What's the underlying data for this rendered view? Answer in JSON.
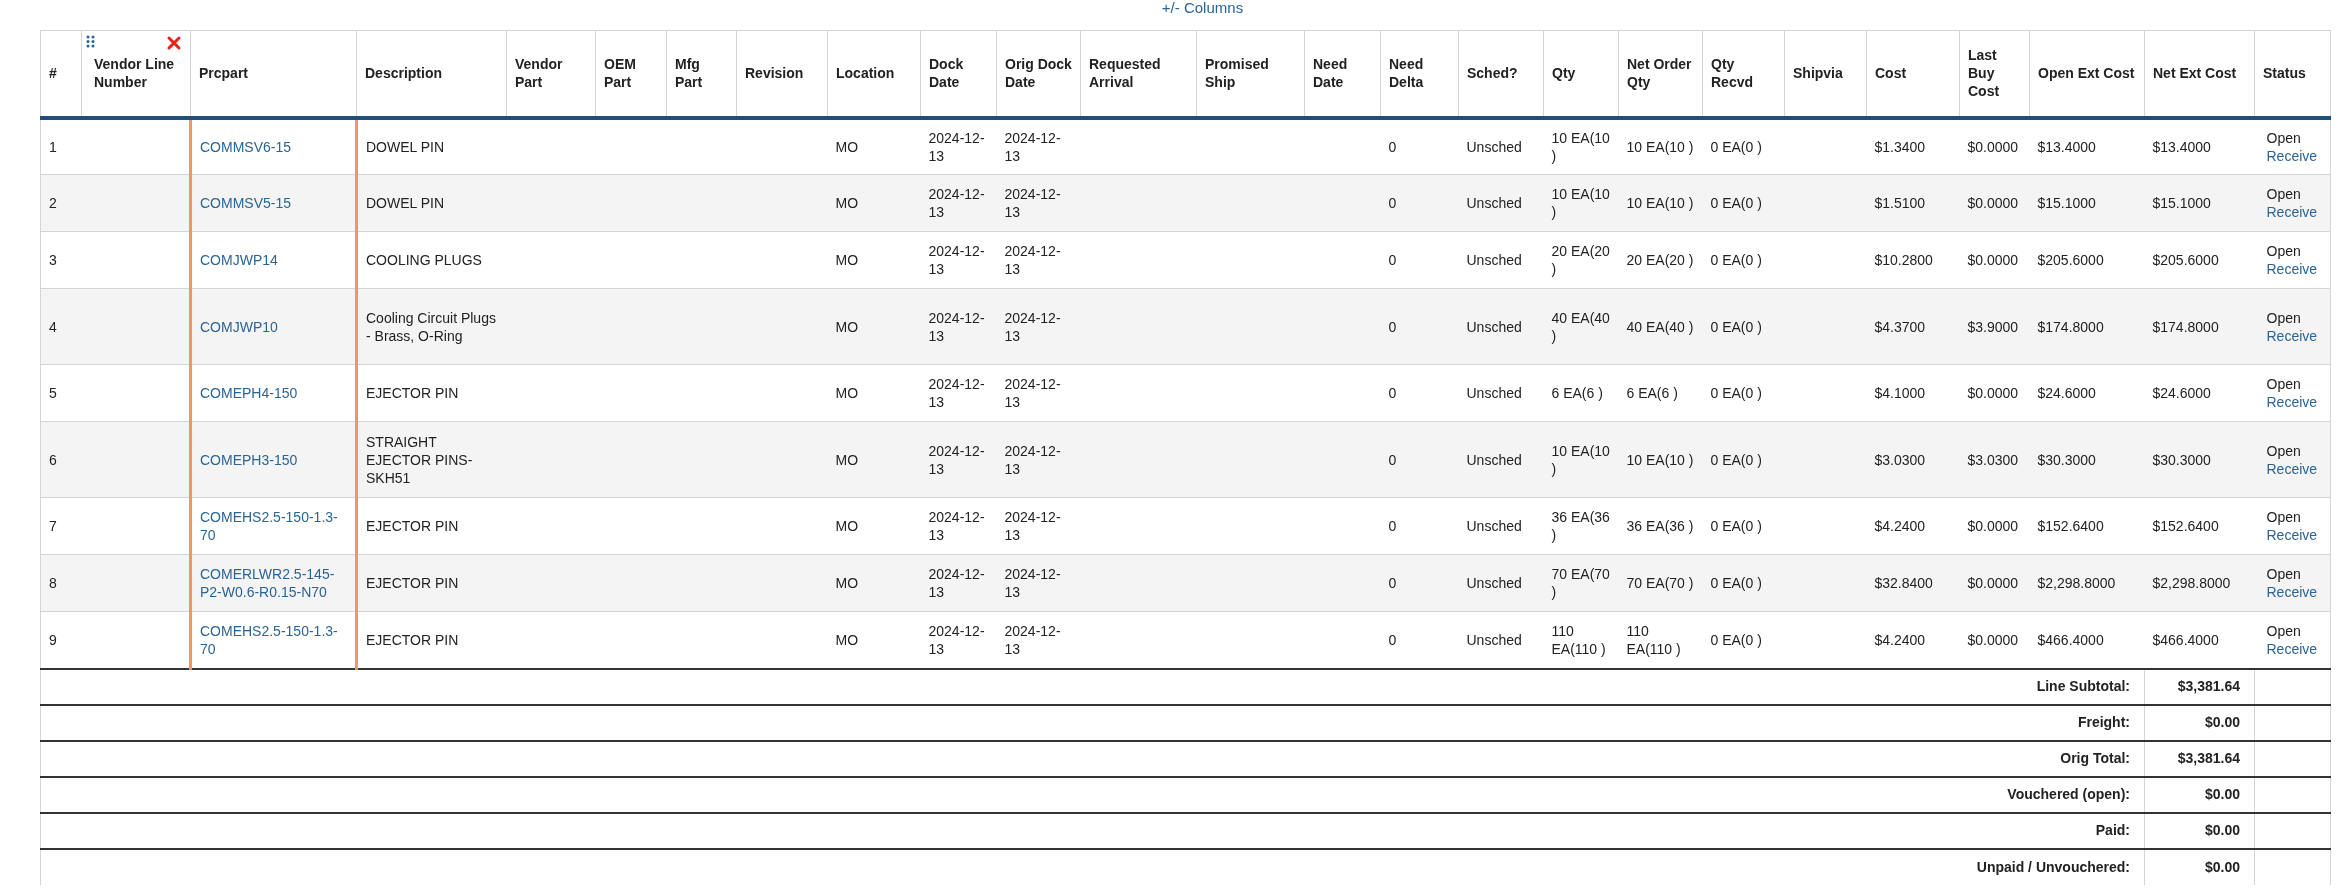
{
  "columns_toggle": "+/- Columns",
  "columns": [
    "#",
    "Vendor Line Number",
    "Prcpart",
    "Description",
    "Vendor Part",
    "OEM Part",
    "Mfg Part",
    "Revision",
    "Location",
    "Dock Date",
    "Orig Dock Date",
    "Requested Arrival",
    "Promised Ship",
    "Need Date",
    "Need Delta",
    "Sched?",
    "Qty",
    "Net Order Qty",
    "Qty Recvd",
    "Shipvia",
    "Cost",
    "Last Buy Cost",
    "Open Ext Cost",
    "Net Ext Cost",
    "Status"
  ],
  "rows": [
    {
      "number": "1",
      "prcpart": "COMMSV6-15",
      "description": "DOWEL PIN",
      "location": "MO",
      "dock_date": "2024-12-13",
      "orig_dock_date": "2024-12-13",
      "need_delta": "0",
      "sched": "Unsched",
      "qty": "10 EA(10 )",
      "net_order_qty": "10 EA(10 )",
      "qty_recvd": "0 EA(0 )",
      "cost": "$1.3400",
      "last_buy_cost": "$0.0000",
      "open_ext_cost": "$13.4000",
      "net_ext_cost": "$13.4000",
      "status": "Open",
      "action": "Receive"
    },
    {
      "number": "2",
      "prcpart": "COMMSV5-15",
      "description": "DOWEL PIN",
      "location": "MO",
      "dock_date": "2024-12-13",
      "orig_dock_date": "2024-12-13",
      "need_delta": "0",
      "sched": "Unsched",
      "qty": "10 EA(10 )",
      "net_order_qty": "10 EA(10 )",
      "qty_recvd": "0 EA(0 )",
      "cost": "$1.5100",
      "last_buy_cost": "$0.0000",
      "open_ext_cost": "$15.1000",
      "net_ext_cost": "$15.1000",
      "status": "Open",
      "action": "Receive"
    },
    {
      "number": "3",
      "prcpart": "COMJWP14",
      "description": "COOLING PLUGS",
      "location": "MO",
      "dock_date": "2024-12-13",
      "orig_dock_date": "2024-12-13",
      "need_delta": "0",
      "sched": "Unsched",
      "qty": "20 EA(20 )",
      "net_order_qty": "20 EA(20 )",
      "qty_recvd": "0 EA(0 )",
      "cost": "$10.2800",
      "last_buy_cost": "$0.0000",
      "open_ext_cost": "$205.6000",
      "net_ext_cost": "$205.6000",
      "status": "Open",
      "action": "Receive"
    },
    {
      "number": "4",
      "prcpart": "COMJWP10",
      "description": "Cooling Circuit Plugs - Brass, O-Ring",
      "location": "MO",
      "dock_date": "2024-12-13",
      "orig_dock_date": "2024-12-13",
      "need_delta": "0",
      "sched": "Unsched",
      "qty": "40 EA(40 )",
      "net_order_qty": "40 EA(40 )",
      "qty_recvd": "0 EA(0 )",
      "cost": "$4.3700",
      "last_buy_cost": "$3.9000",
      "open_ext_cost": "$174.8000",
      "net_ext_cost": "$174.8000",
      "status": "Open",
      "action": "Receive"
    },
    {
      "number": "5",
      "prcpart": "COMEPH4-150",
      "description": "EJECTOR PIN",
      "location": "MO",
      "dock_date": "2024-12-13",
      "orig_dock_date": "2024-12-13",
      "need_delta": "0",
      "sched": "Unsched",
      "qty": "6 EA(6 )",
      "net_order_qty": "6 EA(6 )",
      "qty_recvd": "0 EA(0 )",
      "cost": "$4.1000",
      "last_buy_cost": "$0.0000",
      "open_ext_cost": "$24.6000",
      "net_ext_cost": "$24.6000",
      "status": "Open",
      "action": "Receive"
    },
    {
      "number": "6",
      "prcpart": "COMEPH3-150",
      "description": "STRAIGHT EJECTOR PINS-SKH51",
      "location": "MO",
      "dock_date": "2024-12-13",
      "orig_dock_date": "2024-12-13",
      "need_delta": "0",
      "sched": "Unsched",
      "qty": "10 EA(10 )",
      "net_order_qty": "10 EA(10 )",
      "qty_recvd": "0 EA(0 )",
      "cost": "$3.0300",
      "last_buy_cost": "$3.0300",
      "open_ext_cost": "$30.3000",
      "net_ext_cost": "$30.3000",
      "status": "Open",
      "action": "Receive"
    },
    {
      "number": "7",
      "prcpart": "COMEHS2.5-150-1.3-70",
      "description": "EJECTOR PIN",
      "location": "MO",
      "dock_date": "2024-12-13",
      "orig_dock_date": "2024-12-13",
      "need_delta": "0",
      "sched": "Unsched",
      "qty": "36 EA(36 )",
      "net_order_qty": "36 EA(36 )",
      "qty_recvd": "0 EA(0 )",
      "cost": "$4.2400",
      "last_buy_cost": "$0.0000",
      "open_ext_cost": "$152.6400",
      "net_ext_cost": "$152.6400",
      "status": "Open",
      "action": "Receive"
    },
    {
      "number": "8",
      "prcpart": "COMERLWR2.5-145-P2-W0.6-R0.15-N70",
      "description": "EJECTOR PIN",
      "location": "MO",
      "dock_date": "2024-12-13",
      "orig_dock_date": "2024-12-13",
      "need_delta": "0",
      "sched": "Unsched",
      "qty": "70 EA(70 )",
      "net_order_qty": "70 EA(70 )",
      "qty_recvd": "0 EA(0 )",
      "cost": "$32.8400",
      "last_buy_cost": "$0.0000",
      "open_ext_cost": "$2,298.8000",
      "net_ext_cost": "$2,298.8000",
      "status": "Open",
      "action": "Receive"
    },
    {
      "number": "9",
      "prcpart": "COMEHS2.5-150-1.3-70",
      "description": "EJECTOR PIN",
      "location": "MO",
      "dock_date": "2024-12-13",
      "orig_dock_date": "2024-12-13",
      "need_delta": "0",
      "sched": "Unsched",
      "qty": "110 EA(110 )",
      "net_order_qty": "110 EA(110 )",
      "qty_recvd": "0 EA(0 )",
      "cost": "$4.2400",
      "last_buy_cost": "$0.0000",
      "open_ext_cost": "$466.4000",
      "net_ext_cost": "$466.4000",
      "status": "Open",
      "action": "Receive"
    }
  ],
  "totals": [
    {
      "label": "Line Subtotal:",
      "value": "$3,381.64"
    },
    {
      "label": "Freight:",
      "value": "$0.00"
    },
    {
      "label": "Orig Total:",
      "value": "$3,381.64"
    },
    {
      "label": "Vouchered (open):",
      "value": "$0.00"
    },
    {
      "label": "Paid:",
      "value": "$0.00"
    },
    {
      "label": "Unpaid / Unvouchered:",
      "value": "$0.00"
    }
  ]
}
